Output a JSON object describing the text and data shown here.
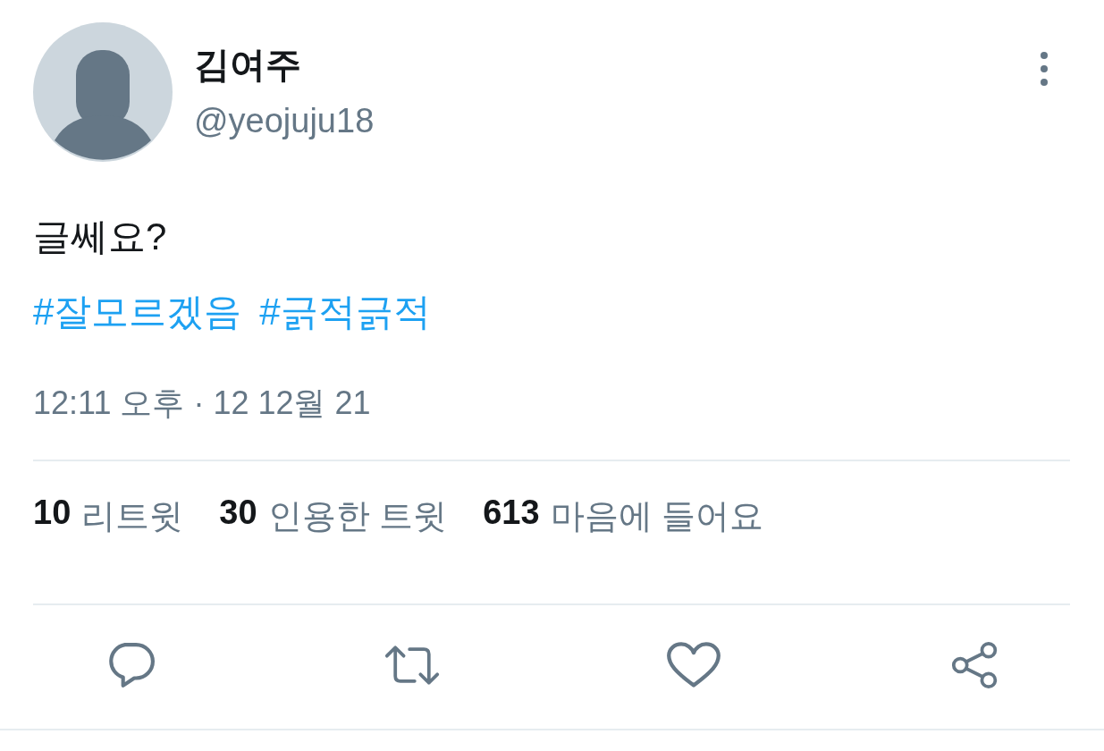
{
  "author": {
    "name": "김여주",
    "handle": "@yeojuju18"
  },
  "text": "글쎄요?",
  "hashtags": [
    "#잘모르겠음",
    "#긁적긁적"
  ],
  "timestamp": "12:11 오후 · 12 12월 21",
  "stats": [
    {
      "count": "10",
      "label": "리트윗"
    },
    {
      "count": "30",
      "label": "인용한 트윗"
    },
    {
      "count": "613",
      "label": "마음에 들어요"
    }
  ],
  "actions": [
    {
      "kind": "reply"
    },
    {
      "kind": "retweet"
    },
    {
      "kind": "like"
    },
    {
      "kind": "share"
    }
  ]
}
